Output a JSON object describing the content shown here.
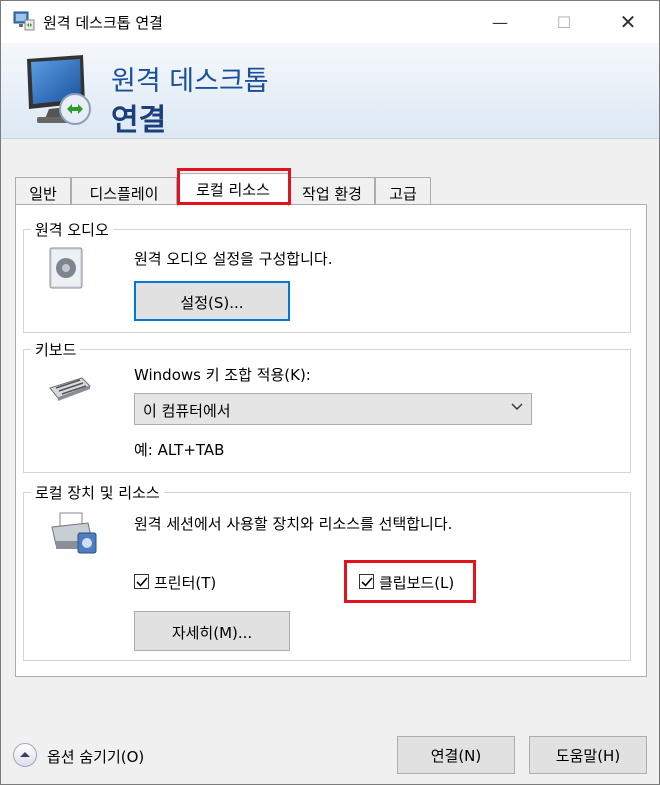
{
  "window": {
    "title": "원격 데스크톱 연결",
    "min_glyph": "—",
    "max_glyph": "☐",
    "close_glyph": "✕"
  },
  "banner": {
    "line1": "원격 데스크톱",
    "line2": "연결"
  },
  "tabs": [
    {
      "label": "일반"
    },
    {
      "label": "디스플레이"
    },
    {
      "label": "로컬 리소스",
      "selected": true
    },
    {
      "label": "작업 환경"
    },
    {
      "label": "고급"
    }
  ],
  "audio": {
    "group_label": "원격 오디오",
    "description": "원격 오디오 설정을 구성합니다.",
    "settings_button": "설정(S)..."
  },
  "keyboard": {
    "group_label": "키보드",
    "combo_label": "Windows 키 조합 적용(K):",
    "combo_value": "이 컴퓨터에서",
    "example": "예: ALT+TAB"
  },
  "devices": {
    "group_label": "로컬 장치 및 리소스",
    "description": "원격 세션에서 사용할 장치와 리소스를 선택합니다.",
    "printer_label": "프린터(T)",
    "printer_checked": true,
    "clipboard_label": "클립보드(L)",
    "clipboard_checked": true,
    "more_button": "자세히(M)..."
  },
  "footer": {
    "toggle_label": "옵션 숨기기(O)",
    "connect_button": "연결(N)",
    "help_button": "도움말(H)"
  },
  "colors": {
    "highlight": "#e0141e",
    "accent": "#0078d7",
    "banner_text": "#1b4f9c"
  }
}
